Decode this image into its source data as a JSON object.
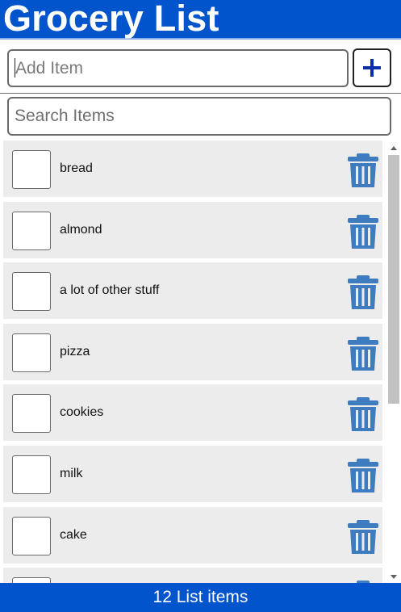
{
  "app": {
    "title": "Grocery List"
  },
  "add_item": {
    "placeholder": "Add Item",
    "button_icon": "plus-icon"
  },
  "search": {
    "placeholder": "Search Items"
  },
  "items": [
    {
      "label": "bread",
      "checked": false
    },
    {
      "label": "almond",
      "checked": false
    },
    {
      "label": "a lot of other stuff",
      "checked": false
    },
    {
      "label": "pizza",
      "checked": false
    },
    {
      "label": "cookies",
      "checked": false
    },
    {
      "label": "milk",
      "checked": false
    },
    {
      "label": "cake",
      "checked": false
    },
    {
      "label": "",
      "checked": false
    }
  ],
  "footer": {
    "count_text": "12 List items"
  },
  "colors": {
    "brand": "#0154cc",
    "trash_icon": "#3f7bbf",
    "plus_icon": "#0a2fa8",
    "item_background": "#ececec"
  }
}
